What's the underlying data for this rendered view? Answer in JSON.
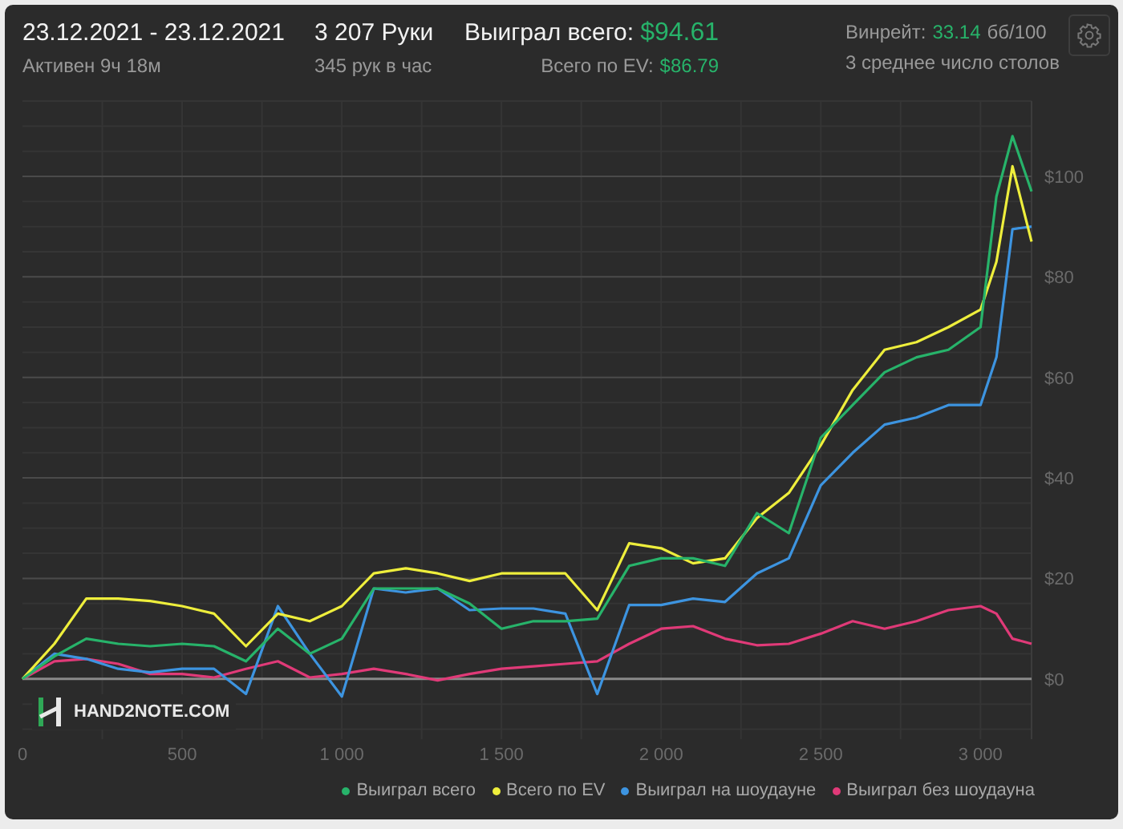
{
  "header": {
    "date_range": "23.12.2021 - 23.12.2021",
    "active_time": "Активен 9ч 18м",
    "hands": "3 207 Руки",
    "hands_per_hour": "345 рук в час",
    "won_label": "Выиграл всего:",
    "won_value": "$94.61",
    "ev_label": "Всего по EV:",
    "ev_value": "$86.79",
    "winrate_label": "Винрейт:",
    "winrate_value": "33.14",
    "winrate_unit": "бб/100",
    "avg_tables": "3 среднее число столов"
  },
  "chart": {
    "watermark": "HAND2NOTE.COM",
    "chart_data": {
      "type": "line",
      "grid": true,
      "x": [
        0,
        100,
        200,
        300,
        400,
        500,
        600,
        700,
        800,
        900,
        1000,
        1100,
        1200,
        1300,
        1400,
        1500,
        1600,
        1700,
        1800,
        1900,
        2000,
        2100,
        2200,
        2300,
        2400,
        2500,
        2600,
        2700,
        2800,
        2900,
        3000,
        3050,
        3100,
        3160
      ],
      "xlim": [
        0,
        3160
      ],
      "ylim": [
        -12,
        115
      ],
      "xticks": [
        {
          "value": 0,
          "label": "0"
        },
        {
          "value": 500,
          "label": "500"
        },
        {
          "value": 1000,
          "label": "1 000"
        },
        {
          "value": 1500,
          "label": "1 500"
        },
        {
          "value": 2000,
          "label": "2 000"
        },
        {
          "value": 2500,
          "label": "2 500"
        },
        {
          "value": 3000,
          "label": "3 000"
        }
      ],
      "yticks": [
        {
          "value": 0,
          "label": "$0"
        },
        {
          "value": 20,
          "label": "$20"
        },
        {
          "value": 40,
          "label": "$40"
        },
        {
          "value": 60,
          "label": "$60"
        },
        {
          "value": 80,
          "label": "$80"
        },
        {
          "value": 100,
          "label": "$100"
        }
      ],
      "series": [
        {
          "name": "Выиграл всего",
          "color": "#27b36a",
          "values": [
            0,
            4.5,
            8,
            7,
            6.5,
            7,
            6.5,
            3.5,
            10,
            5,
            8,
            18,
            18,
            18,
            15,
            10,
            11.5,
            11.5,
            12,
            22.5,
            24,
            24,
            22.5,
            33,
            29,
            48,
            54.5,
            61,
            64,
            65.5,
            70,
            96,
            108,
            97
          ]
        },
        {
          "name": "Всего по EV",
          "color": "#eeee3c",
          "values": [
            0,
            7,
            16,
            16,
            15.5,
            14.5,
            13,
            6.5,
            13,
            11.5,
            14.5,
            21,
            22,
            21,
            19.5,
            21,
            21,
            21,
            13.7,
            27,
            26,
            23,
            24,
            32,
            37,
            46.5,
            57.5,
            65.5,
            67,
            70,
            73.5,
            83,
            102,
            87
          ]
        },
        {
          "name": "Выиграл на шоудауне",
          "color": "#3d94e0",
          "values": [
            0,
            5,
            4,
            2,
            1.3,
            2,
            2,
            -3,
            14.5,
            5,
            -3.5,
            18,
            17.2,
            18,
            13.7,
            14,
            14,
            13,
            -3,
            14.7,
            14.7,
            16,
            15.3,
            21,
            24,
            38.5,
            45,
            50.6,
            52,
            54.5,
            54.5,
            64,
            89.5,
            90
          ]
        },
        {
          "name": "Выиграл без шоудауна",
          "color": "#e03a78",
          "values": [
            0,
            3.5,
            4,
            3,
            1,
            1,
            0.3,
            2,
            3.5,
            0.3,
            1,
            2,
            1,
            -0.3,
            1,
            2,
            2.5,
            3,
            3.5,
            7,
            10,
            10.5,
            8,
            6.7,
            7,
            9,
            11.5,
            10,
            11.5,
            13.7,
            14.5,
            13,
            8,
            7
          ]
        }
      ]
    }
  }
}
